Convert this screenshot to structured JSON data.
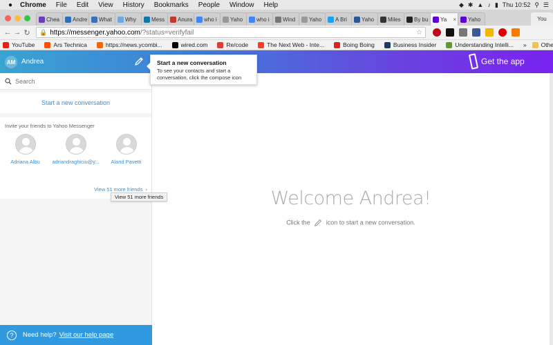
{
  "menubar": {
    "app": "Chrome",
    "menus": [
      "File",
      "Edit",
      "View",
      "History",
      "Bookmarks",
      "People",
      "Window",
      "Help"
    ],
    "clock": "Thu 10:52"
  },
  "tabs": [
    {
      "label": "Chea",
      "color": "#6a3fb5"
    },
    {
      "label": "Andre",
      "color": "#2f6fb5"
    },
    {
      "label": "What",
      "color": "#3b6fb5"
    },
    {
      "label": "Why",
      "color": "#6aa8e0"
    },
    {
      "label": "Mess",
      "color": "#0e76a8"
    },
    {
      "label": "Anura",
      "color": "#c0392b"
    },
    {
      "label": "who i",
      "color": "#4285f4"
    },
    {
      "label": "Yaho",
      "color": "#999999"
    },
    {
      "label": "who i",
      "color": "#4285f4"
    },
    {
      "label": "Wind",
      "color": "#777777"
    },
    {
      "label": "Yaho",
      "color": "#999999"
    },
    {
      "label": "A Bri",
      "color": "#1da1f2"
    },
    {
      "label": "Yaho",
      "color": "#2b5797"
    },
    {
      "label": "Miles",
      "color": "#333333"
    },
    {
      "label": "By bu",
      "color": "#222222"
    },
    {
      "label": "Ya",
      "color": "#5f01d1",
      "active": true
    },
    {
      "label": "Yaho",
      "color": "#5f01d1"
    }
  ],
  "profile_tab": "You",
  "toolbar": {
    "url_host": "https://messenger.yahoo.com",
    "url_path": "/?status=verifyfail"
  },
  "bookmarks": [
    {
      "label": "YouTube",
      "color": "#e62117"
    },
    {
      "label": "Ars Technica",
      "color": "#ff4e00"
    },
    {
      "label": "https://news.ycombi...",
      "color": "#ff6600"
    },
    {
      "label": "wired.com",
      "color": "#000000"
    },
    {
      "label": "Re/code",
      "color": "#e53935"
    },
    {
      "label": "The Next Web - Inte...",
      "color": "#ff3c1f"
    },
    {
      "label": "Boing Boing",
      "color": "#e0201b"
    },
    {
      "label": "Business Insider",
      "color": "#1e3a5f"
    },
    {
      "label": "Understanding Intelli...",
      "color": "#5aa02c"
    }
  ],
  "bookmarks_other": "Other Bookmarks",
  "app": {
    "user_initials": "AM",
    "user_name": "Andrea",
    "get_app": "Get the app"
  },
  "tooltip": {
    "title": "Start a new conversation",
    "body": "To see your contacts and start a conversation, click the compose icon"
  },
  "sidebar": {
    "search_placeholder": "Search",
    "start_conversation": "Start a new conversation",
    "invite_title": "Invite your friends to Yahoo Messenger",
    "friends": [
      {
        "name": "Adriana Albu"
      },
      {
        "name": "adriandraghiciu@y..."
      },
      {
        "name": "Aland Pavetti"
      }
    ],
    "view_more": "View 51 more friends",
    "view_more_tip": "View 51 more friends",
    "help_prefix": "Need help?",
    "help_link": "Visit our help page"
  },
  "main": {
    "welcome": "Welcome Andrea!",
    "sub_before": "Click the",
    "sub_after": "icon to start a new conversation."
  }
}
